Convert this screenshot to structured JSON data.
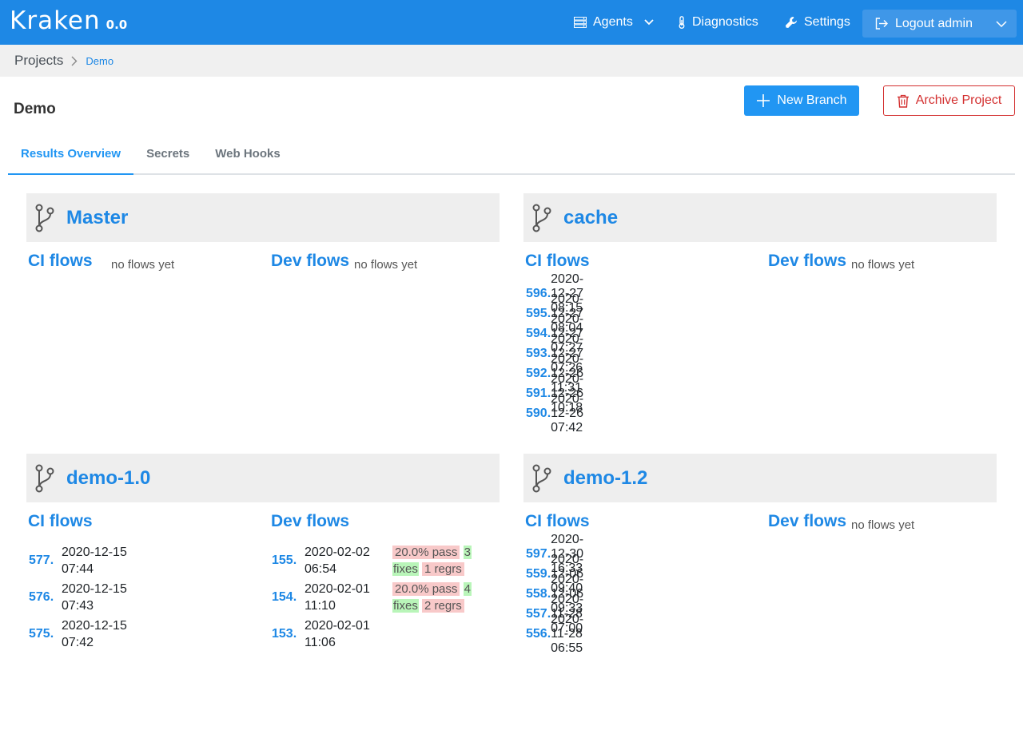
{
  "app": {
    "logo": "Kraken",
    "version": "0.0"
  },
  "nav": {
    "agents": "Agents",
    "diagnostics": "Diagnostics",
    "settings": "Settings",
    "logout": "Logout admin"
  },
  "breadcrumb": {
    "root": "Projects",
    "current": "Demo"
  },
  "page": {
    "title": "Demo",
    "new_branch": "New Branch",
    "archive": "Archive Project"
  },
  "tabs": [
    "Results Overview",
    "Secrets",
    "Web Hooks"
  ],
  "labels": {
    "ci": "CI flows",
    "dev": "Dev flows",
    "none": "no flows yet"
  },
  "branches": [
    {
      "name": "Master"
    },
    {
      "name": "cache",
      "ci": [
        {
          "num": "596.",
          "date": "2020-12-27 08:15"
        },
        {
          "num": "595.",
          "date": "2020-12-27 08:04"
        },
        {
          "num": "594.",
          "date": "2020-12-27 07:27"
        },
        {
          "num": "593.",
          "date": "2020-12-27 07:26"
        },
        {
          "num": "592.",
          "date": "2020-12-26 11:31"
        },
        {
          "num": "591.",
          "date": "2020-12-26 10:18"
        },
        {
          "num": "590.",
          "date": "2020-12-26 07:42"
        }
      ]
    },
    {
      "name": "demo-1.0",
      "ci": [
        {
          "num": "577.",
          "d1": "2020-12-15",
          "d2": "07:44"
        },
        {
          "num": "576.",
          "d1": "2020-12-15",
          "d2": "07:43"
        },
        {
          "num": "575.",
          "d1": "2020-12-15",
          "d2": "07:42"
        }
      ],
      "dev": [
        {
          "num": "155.",
          "d1": "2020-02-02",
          "d2": "06:54",
          "pass": "20.0% pass",
          "fixes_n": "3",
          "fixes": "fixes",
          "regrs": "1 regrs"
        },
        {
          "num": "154.",
          "d1": "2020-02-01",
          "d2": "11:10",
          "pass": "20.0% pass",
          "fixes_n": "4",
          "fixes": "fixes",
          "regrs": "2 regrs"
        },
        {
          "num": "153.",
          "d1": "2020-02-01",
          "d2": "11:06"
        }
      ]
    },
    {
      "name": "demo-1.2",
      "ci": [
        {
          "num": "597.",
          "date": "2020-12-30 16:33"
        },
        {
          "num": "559.",
          "date": "2020-12-06 09:40"
        },
        {
          "num": "558.",
          "date": "2020-12-06 09:33"
        },
        {
          "num": "557.",
          "date": "2020-11-28 07:00"
        },
        {
          "num": "556.",
          "date": "2020-11-28 06:55"
        }
      ]
    }
  ],
  "colors": {
    "primary": "#1e88e5",
    "danger": "#d32f2f",
    "header_bg": "#eeeeee"
  }
}
